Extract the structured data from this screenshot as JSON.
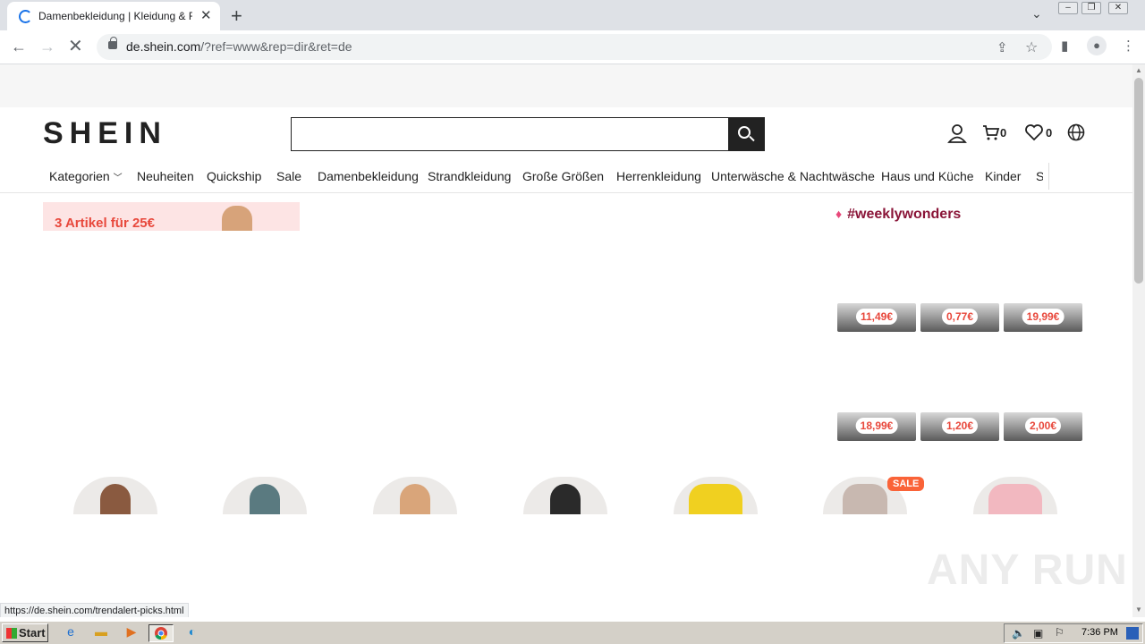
{
  "browser": {
    "tab_title": "Damenbekleidung | Kleidung & Fashion",
    "new_tab_icon": "+",
    "url_host": "de.shein.com",
    "url_path": "/?ref=www&rep=dir&ret=de",
    "status_url": "https://de.shein.com/trendalert-picks.html"
  },
  "header": {
    "logo": "SHEIN",
    "search_value": "",
    "cart_count": "0",
    "wishlist_count": "0"
  },
  "nav": {
    "items": [
      "Kategorien",
      "Neuheiten",
      "Quickship",
      "Sale",
      "Damenbekleidung",
      "Strandkleidung",
      "Große Größen",
      "Herrenkleidung",
      "Unterwäsche & Nachtwäsche",
      "Haus und Küche",
      "Kinder",
      "S"
    ]
  },
  "banner": {
    "text": "3 Artikel für 25€"
  },
  "weekly": {
    "title": "#weeklywonders",
    "prices_row1": [
      "11,49€",
      "0,77€",
      "19,99€"
    ],
    "prices_row2": [
      "18,99€",
      "1,20€",
      "2,00€"
    ]
  },
  "categories": {
    "sale_badge": "SALE"
  },
  "watermark": "ANY RUN",
  "taskbar": {
    "start": "Start",
    "clock": "7:36 PM"
  },
  "colors": {
    "accent": "#e8483c",
    "weekly": "#8a1538",
    "sale": "#fa6338"
  }
}
